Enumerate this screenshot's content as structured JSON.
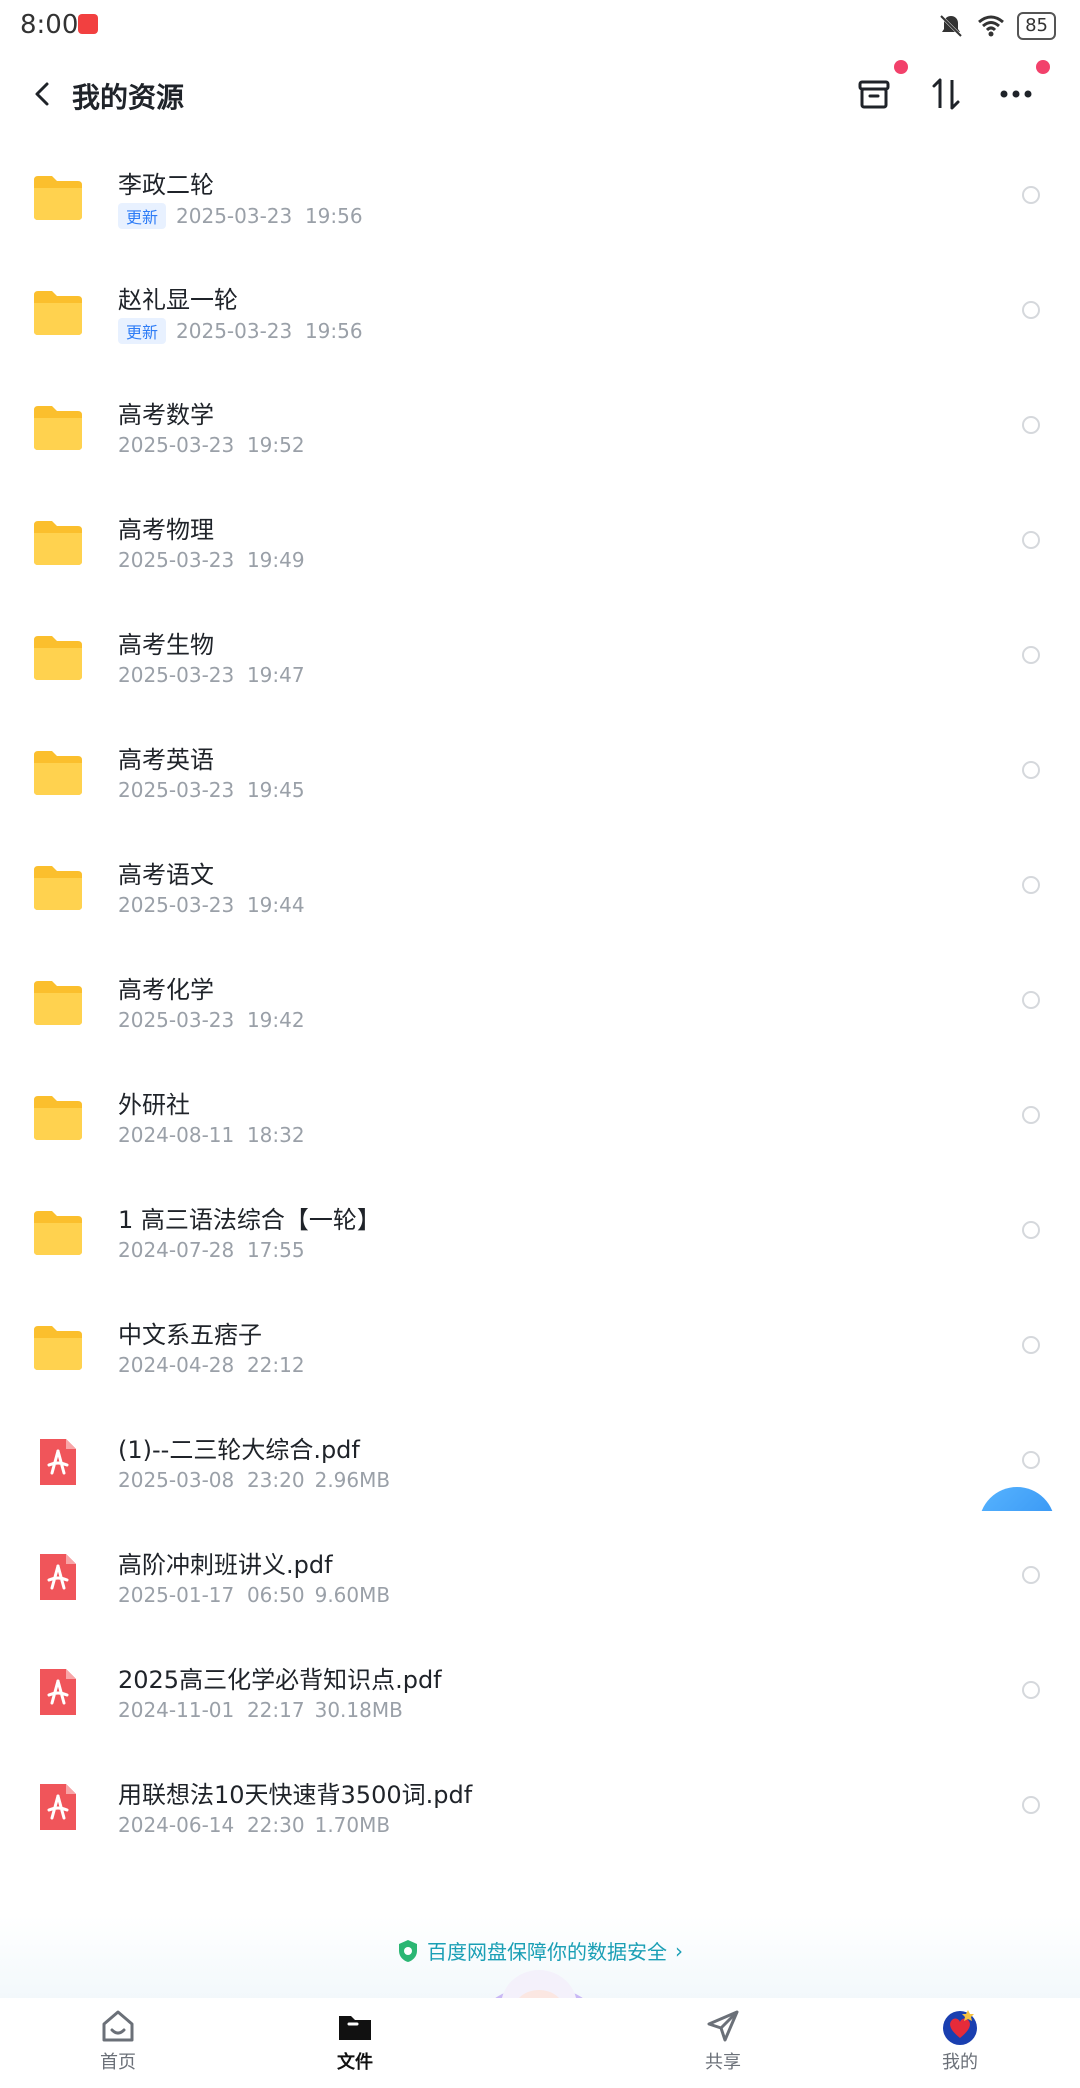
{
  "status": {
    "time": "8:00",
    "battery": "85"
  },
  "header": {
    "title": "我的资源"
  },
  "rows": [
    {
      "type": "folder",
      "name": "李政二轮",
      "badge": "更新",
      "date": "2025-03-23  19:56",
      "size": ""
    },
    {
      "type": "folder",
      "name": "赵礼显一轮",
      "badge": "更新",
      "date": "2025-03-23  19:56",
      "size": ""
    },
    {
      "type": "folder",
      "name": "高考数学",
      "badge": "",
      "date": "2025-03-23  19:52",
      "size": ""
    },
    {
      "type": "folder",
      "name": "高考物理",
      "badge": "",
      "date": "2025-03-23  19:49",
      "size": ""
    },
    {
      "type": "folder",
      "name": "高考生物",
      "badge": "",
      "date": "2025-03-23  19:47",
      "size": ""
    },
    {
      "type": "folder",
      "name": "高考英语",
      "badge": "",
      "date": "2025-03-23  19:45",
      "size": ""
    },
    {
      "type": "folder",
      "name": "高考语文",
      "badge": "",
      "date": "2025-03-23  19:44",
      "size": ""
    },
    {
      "type": "folder",
      "name": "高考化学",
      "badge": "",
      "date": "2025-03-23  19:42",
      "size": ""
    },
    {
      "type": "folder",
      "name": "外研社",
      "badge": "",
      "date": "2024-08-11  18:32",
      "size": ""
    },
    {
      "type": "folder",
      "name": "1 高三语法综合【一轮】",
      "badge": "",
      "date": "2024-07-28  17:55",
      "size": ""
    },
    {
      "type": "folder",
      "name": "中文系五痞子",
      "badge": "",
      "date": "2024-04-28  22:12",
      "size": ""
    },
    {
      "type": "pdf",
      "name": "(1)--二三轮大综合.pdf",
      "badge": "",
      "date": "2025-03-08  23:20",
      "size": "2.96MB"
    },
    {
      "type": "pdf",
      "name": "高阶冲刺班讲义.pdf",
      "badge": "",
      "date": "2025-01-17  06:50",
      "size": "9.60MB"
    },
    {
      "type": "pdf",
      "name": "2025高三化学必背知识点.pdf",
      "badge": "",
      "date": "2024-11-01  22:17",
      "size": "30.18MB"
    },
    {
      "type": "pdf",
      "name": "用联想法10天快速背3500词.pdf",
      "badge": "",
      "date": "2024-06-14  22:30",
      "size": "1.70MB"
    }
  ],
  "security": {
    "text": "百度网盘保障你的数据安全",
    "arrow": "›"
  },
  "tabs": {
    "home": "首页",
    "files": "文件",
    "share": "共享",
    "mine": "我的"
  },
  "colors": {
    "folder": "#fbbf2d",
    "pdf": "#f0555a",
    "accent": "#2f7df6",
    "red_dot": "#f2416b"
  }
}
